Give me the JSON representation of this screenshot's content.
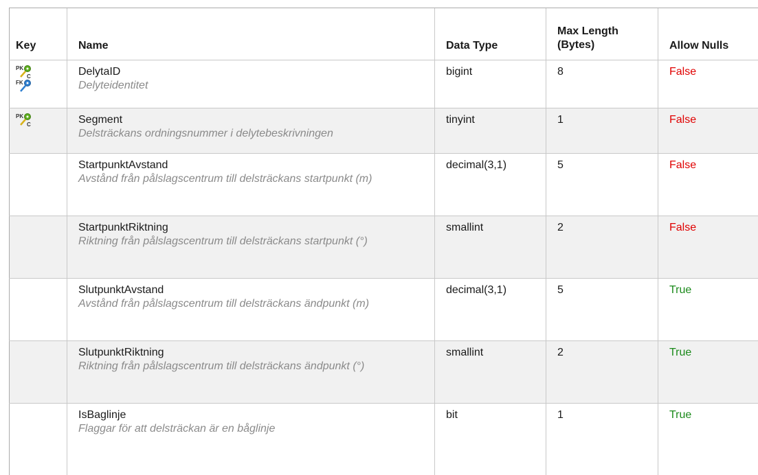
{
  "headers": {
    "key": "Key",
    "name": "Name",
    "data_type": "Data Type",
    "max_length": "Max Length (Bytes)",
    "allow_nulls": "Allow Nulls"
  },
  "rows": [
    {
      "keys": [
        "pk-clustered-key-icon",
        "fk-key-icon"
      ],
      "name": "DelytaID",
      "description": "Delyteidentitet",
      "data_type": "bigint",
      "max_length": "8",
      "allow_nulls": "False"
    },
    {
      "keys": [
        "pk-clustered-key-icon"
      ],
      "name": "Segment",
      "description": "Delsträckans ordningsnummer i delytebeskrivningen",
      "data_type": "tinyint",
      "max_length": "1",
      "allow_nulls": "False"
    },
    {
      "keys": [],
      "name": "StartpunktAvstand",
      "description": "Avstånd från pålslagscentrum till delsträckans startpunkt (m)",
      "data_type": "decimal(3,1)",
      "max_length": "5",
      "allow_nulls": "False"
    },
    {
      "keys": [],
      "name": "StartpunktRiktning",
      "description": "Riktning från pålslagscentrum till delsträckans startpunkt (°)",
      "data_type": "smallint",
      "max_length": "2",
      "allow_nulls": "False"
    },
    {
      "keys": [],
      "name": "SlutpunktAvstand",
      "description": "Avstånd från pålslagscentrum till delsträckans ändpunkt (m)",
      "data_type": "decimal(3,1)",
      "max_length": "5",
      "allow_nulls": "True"
    },
    {
      "keys": [],
      "name": "SlutpunktRiktning",
      "description": "Riktning från pålslagscentrum till delsträckans ändpunkt (°)",
      "data_type": "smallint",
      "max_length": "2",
      "allow_nulls": "True"
    },
    {
      "keys": [],
      "name": "IsBaglinje",
      "description": "Flaggar för att delsträckan är en båglinje",
      "data_type": "bit",
      "max_length": "1",
      "allow_nulls": "True"
    }
  ],
  "icon_labels": {
    "pk": "PK",
    "fk": "FK",
    "c": "C"
  },
  "colors": {
    "false": "#e00000",
    "true": "#1b8a1b",
    "pk_key": "#5fae1f",
    "fk_key": "#2f7fd0",
    "key_shaft": "#d8b21a"
  }
}
